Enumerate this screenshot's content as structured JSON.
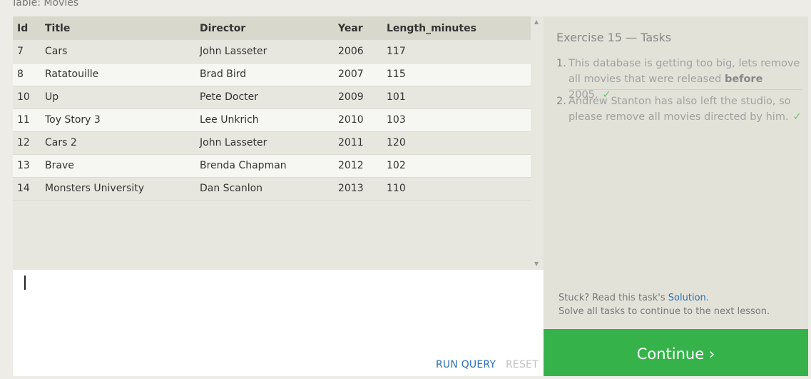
{
  "table_caption": "Table: Movies",
  "table": {
    "columns": [
      "Id",
      "Title",
      "Director",
      "Year",
      "Length_minutes"
    ],
    "rows": [
      [
        "7",
        "Cars",
        "John Lasseter",
        "2006",
        "117"
      ],
      [
        "8",
        "Ratatouille",
        "Brad Bird",
        "2007",
        "115"
      ],
      [
        "10",
        "Up",
        "Pete Docter",
        "2009",
        "101"
      ],
      [
        "11",
        "Toy Story 3",
        "Lee Unkrich",
        "2010",
        "103"
      ],
      [
        "12",
        "Cars 2",
        "John Lasseter",
        "2011",
        "120"
      ],
      [
        "13",
        "Brave",
        "Brenda Chapman",
        "2012",
        "102"
      ],
      [
        "14",
        "Monsters University",
        "Dan Scanlon",
        "2013",
        "110"
      ]
    ]
  },
  "scrollbar": {
    "up_icon": "▲",
    "down_icon": "▼"
  },
  "editor": {
    "run_label": "RUN QUERY",
    "reset_label": "RESET"
  },
  "tasks": {
    "title": "Exercise 15 — Tasks",
    "items": [
      {
        "num": "1.",
        "text_before": "This database is getting too big, lets remove all movies that were released ",
        "bold": "before",
        "text_after": " 2005.",
        "check": "✓"
      },
      {
        "num": "2.",
        "text": "Andrew Stanton has also left the studio, so please remove all movies directed by him.",
        "check": "✓"
      }
    ],
    "stuck_prefix": "Stuck? Read this task's ",
    "solution_link": "Solution",
    "stuck_suffix": ".",
    "solve_all": "Solve all tasks to continue to the next lesson."
  },
  "continue_label": "Continue ›",
  "colors": {
    "accent": "#35b34a",
    "link": "#2a6fb5",
    "check": "#6fc36f"
  }
}
